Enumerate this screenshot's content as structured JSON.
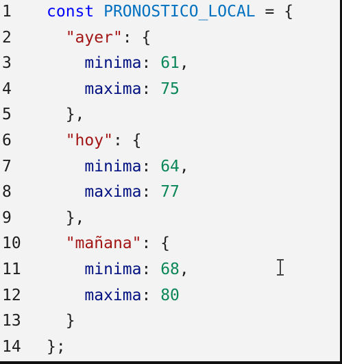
{
  "editor": {
    "lines": [
      {
        "num": "1",
        "parts": [
          {
            "t": "const ",
            "c": "kw"
          },
          {
            "t": "PRONOSTICO_LOCAL",
            "c": "id"
          },
          {
            "t": " = {",
            "c": "punc"
          }
        ]
      },
      {
        "num": "2",
        "parts": [
          {
            "t": "  ",
            "c": "punc"
          },
          {
            "t": "\"ayer\"",
            "c": "str"
          },
          {
            "t": ": {",
            "c": "punc"
          }
        ]
      },
      {
        "num": "3",
        "parts": [
          {
            "t": "    minima",
            "c": "prop"
          },
          {
            "t": ": ",
            "c": "punc"
          },
          {
            "t": "61",
            "c": "num"
          },
          {
            "t": ",",
            "c": "punc"
          }
        ]
      },
      {
        "num": "4",
        "parts": [
          {
            "t": "    maxima",
            "c": "prop"
          },
          {
            "t": ": ",
            "c": "punc"
          },
          {
            "t": "75",
            "c": "num"
          }
        ]
      },
      {
        "num": "5",
        "parts": [
          {
            "t": "  },",
            "c": "punc"
          }
        ]
      },
      {
        "num": "6",
        "parts": [
          {
            "t": "  ",
            "c": "punc"
          },
          {
            "t": "\"hoy\"",
            "c": "str"
          },
          {
            "t": ": {",
            "c": "punc"
          }
        ]
      },
      {
        "num": "7",
        "parts": [
          {
            "t": "    minima",
            "c": "prop"
          },
          {
            "t": ": ",
            "c": "punc"
          },
          {
            "t": "64",
            "c": "num"
          },
          {
            "t": ",",
            "c": "punc"
          }
        ]
      },
      {
        "num": "8",
        "parts": [
          {
            "t": "    maxima",
            "c": "prop"
          },
          {
            "t": ": ",
            "c": "punc"
          },
          {
            "t": "77",
            "c": "num"
          }
        ]
      },
      {
        "num": "9",
        "parts": [
          {
            "t": "  },",
            "c": "punc"
          }
        ]
      },
      {
        "num": "10",
        "parts": [
          {
            "t": "  ",
            "c": "punc"
          },
          {
            "t": "\"mañana\"",
            "c": "str"
          },
          {
            "t": ": {",
            "c": "punc"
          }
        ]
      },
      {
        "num": "11",
        "parts": [
          {
            "t": "    minima",
            "c": "prop"
          },
          {
            "t": ": ",
            "c": "punc"
          },
          {
            "t": "68",
            "c": "num"
          },
          {
            "t": ",",
            "c": "punc"
          }
        ]
      },
      {
        "num": "12",
        "parts": [
          {
            "t": "    maxima",
            "c": "prop"
          },
          {
            "t": ": ",
            "c": "punc"
          },
          {
            "t": "80",
            "c": "num"
          }
        ]
      },
      {
        "num": "13",
        "parts": [
          {
            "t": "  }",
            "c": "punc"
          }
        ]
      },
      {
        "num": "14",
        "parts": [
          {
            "t": "};",
            "c": "punc"
          }
        ]
      }
    ],
    "cursor_icon": "text-cursor-icon",
    "colors": {
      "background": "#f3f3f3",
      "keyword": "#0000ff",
      "identifier": "#0070c1",
      "string": "#a31515",
      "number": "#098658",
      "property": "#001080",
      "text": "#1e1e1e"
    }
  }
}
